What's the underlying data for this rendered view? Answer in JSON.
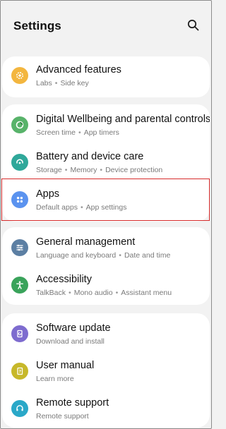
{
  "header": {
    "title": "Settings",
    "search_icon": "search-icon"
  },
  "groups": [
    {
      "items": [
        {
          "id": "advanced",
          "title": "Advanced features",
          "sub": [
            "Labs",
            "Side key"
          ],
          "icon": "gear-plus-icon",
          "color": "#f3b63f"
        }
      ]
    },
    {
      "items": [
        {
          "id": "wellbeing",
          "title": "Digital Wellbeing and parental controls",
          "sub": [
            "Screen time",
            "App timers"
          ],
          "icon": "wellbeing-icon",
          "color": "#58b36a"
        },
        {
          "id": "battery",
          "title": "Battery and device care",
          "sub": [
            "Storage",
            "Memory",
            "Device protection"
          ],
          "icon": "device-care-icon",
          "color": "#2fa89a"
        },
        {
          "id": "apps",
          "title": "Apps",
          "sub": [
            "Default apps",
            "App settings"
          ],
          "icon": "apps-grid-icon",
          "color": "#5b93ef"
        }
      ]
    },
    {
      "items": [
        {
          "id": "general",
          "title": "General management",
          "sub": [
            "Language and keyboard",
            "Date and time"
          ],
          "icon": "sliders-icon",
          "color": "#5c7fa3"
        },
        {
          "id": "accessibility",
          "title": "Accessibility",
          "sub": [
            "TalkBack",
            "Mono audio",
            "Assistant menu"
          ],
          "icon": "accessibility-icon",
          "color": "#3aa35b"
        }
      ]
    },
    {
      "items": [
        {
          "id": "software",
          "title": "Software update",
          "sub": [
            "Download and install"
          ],
          "icon": "software-update-icon",
          "color": "#7e6ccf"
        },
        {
          "id": "manual",
          "title": "User manual",
          "sub": [
            "Learn more"
          ],
          "icon": "manual-icon",
          "color": "#c7b82a"
        },
        {
          "id": "remote",
          "title": "Remote support",
          "sub": [
            "Remote support"
          ],
          "icon": "headset-icon",
          "color": "#2aa8c8"
        }
      ]
    }
  ],
  "highlighted_item": "apps",
  "colors": {
    "highlight": "#d62b2b",
    "background": "#f2f2f2",
    "card": "#ffffff"
  }
}
